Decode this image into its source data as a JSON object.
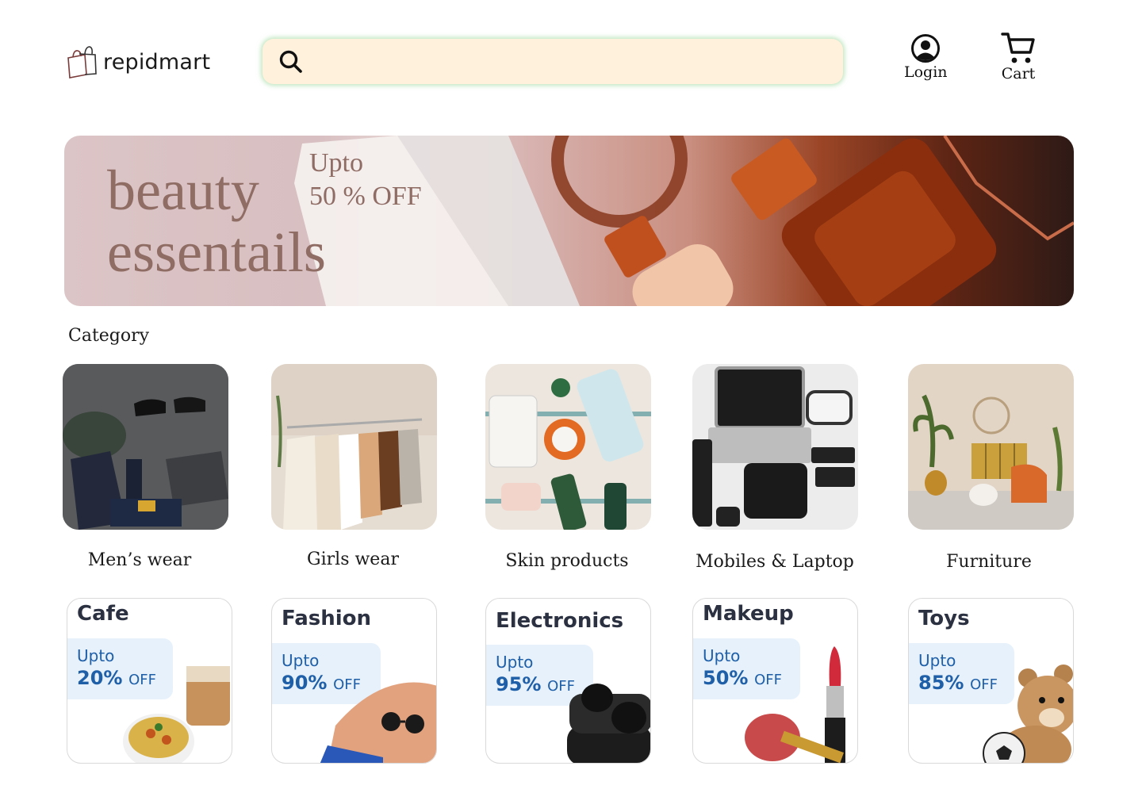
{
  "header": {
    "logo_text": "repidmart",
    "search": {
      "placeholder": "",
      "value": ""
    },
    "login_label": "Login",
    "cart_label": "Cart"
  },
  "banner": {
    "title_line1": "beauty",
    "title_line2": "essentails",
    "offer_line1": "Upto",
    "offer_line2": "50 % OFF"
  },
  "category": {
    "heading": "Category",
    "items": [
      {
        "label": "Men’s wear"
      },
      {
        "label": "Girls wear"
      },
      {
        "label": "Skin products"
      },
      {
        "label": "Mobiles & Laptop"
      },
      {
        "label": "Furniture"
      }
    ]
  },
  "deals": [
    {
      "title": "Cafe",
      "upto": "Upto",
      "percent": "20%",
      "off": "OFF"
    },
    {
      "title": "Fashion",
      "upto": "Upto",
      "percent": "90%",
      "off": "OFF"
    },
    {
      "title": "Electronics",
      "upto": "Upto",
      "percent": "95%",
      "off": "OFF"
    },
    {
      "title": "Makeup",
      "upto": "Upto",
      "percent": "50%",
      "off": "OFF"
    },
    {
      "title": "Toys",
      "upto": "Upto",
      "percent": "85%",
      "off": "OFF"
    }
  ],
  "colors": {
    "search_bg": "#fff1dc",
    "banner_text": "#8f6c64",
    "deal_accent": "#1e5fa8",
    "deal_box": "#e6f1fb"
  }
}
